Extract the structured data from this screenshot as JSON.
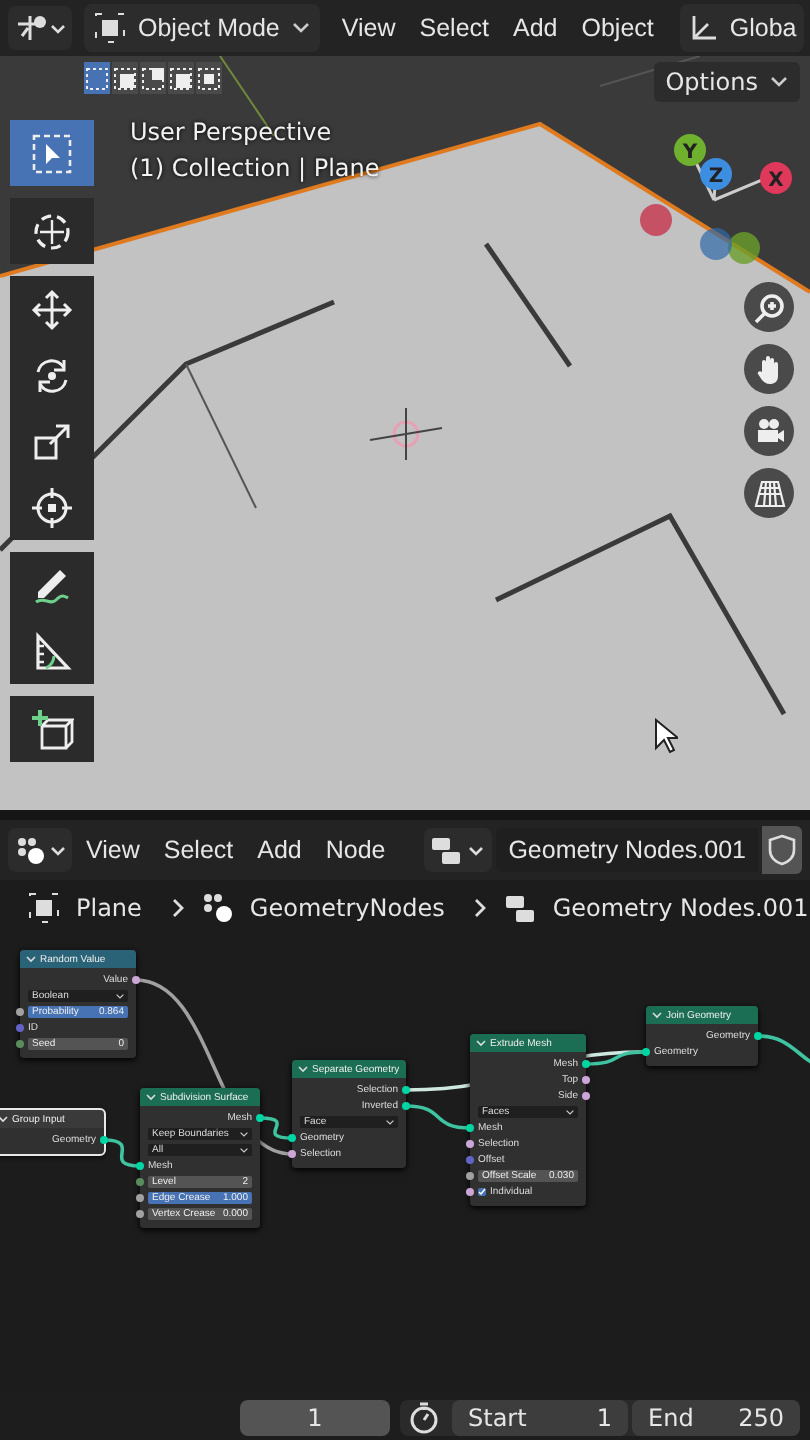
{
  "header": {
    "menus": [
      "View",
      "Select",
      "Add",
      "Object"
    ],
    "mode": "Object Mode",
    "orientation": "Globa"
  },
  "select_modes": [
    {
      "selected": true
    },
    {
      "selected": false
    },
    {
      "selected": false
    },
    {
      "selected": false
    },
    {
      "selected": false
    }
  ],
  "options": "Options",
  "viewport": {
    "view_name": "User Perspective",
    "collection": "(1) Collection | Plane"
  },
  "tools": [
    {
      "kind": "select",
      "selected": true
    },
    {
      "kind": "cursor",
      "selected": false
    },
    {
      "kind": "move",
      "selected": false
    },
    {
      "kind": "rotate",
      "selected": false
    },
    {
      "kind": "scale",
      "selected": false
    },
    {
      "kind": "transform",
      "selected": false
    },
    {
      "kind": "annotate",
      "selected": false
    },
    {
      "kind": "measure",
      "selected": false
    },
    {
      "kind": "add_cube",
      "selected": false
    }
  ],
  "gizmo_axes": [
    "Y",
    "Z",
    "X"
  ],
  "node_editor": {
    "menus": [
      "View",
      "Select",
      "Add",
      "Node"
    ],
    "node_tree": "Geometry Nodes.001",
    "breadcrumbs": [
      "Plane",
      "GeometryNodes",
      "Geometry Nodes.001"
    ],
    "nodes": [
      {
        "title": "Random Value",
        "color": "#2a6378",
        "selected": false,
        "rows": [
          {
            "kind": "output",
            "label": "Value",
            "color": "#cca6d6"
          },
          {
            "kind": "dropdown",
            "label": "Boolean"
          },
          {
            "kind": "field",
            "label": "Probability",
            "value": "0.864",
            "selected": true,
            "color": "#a1a1a1"
          },
          {
            "kind": "input",
            "label": "ID",
            "color": "#6363c7"
          },
          {
            "kind": "field",
            "label": "Seed",
            "value": "0",
            "selected": false,
            "color": "#598c5c"
          }
        ]
      },
      {
        "title": "Group Input",
        "color": "#3a3a3a",
        "selected": true,
        "rows": [
          {
            "kind": "output",
            "label": "Geometry",
            "color": "#00d6a3"
          }
        ]
      },
      {
        "title": "Subdivision Surface",
        "color": "#1b6e53",
        "selected": false,
        "rows": [
          {
            "kind": "output",
            "label": "Mesh",
            "color": "#00d6a3"
          },
          {
            "kind": "dropdown",
            "label": "Keep Boundaries"
          },
          {
            "kind": "dropdown",
            "label": "All"
          },
          {
            "kind": "input",
            "label": "Mesh",
            "color": "#00d6a3"
          },
          {
            "kind": "field",
            "label": "Level",
            "value": "2",
            "selected": false,
            "color": "#598c5c"
          },
          {
            "kind": "field",
            "label": "Edge Crease",
            "value": "1.000",
            "selected": true,
            "color": "#a1a1a1"
          },
          {
            "kind": "field",
            "label": "Vertex Crease",
            "value": "0.000",
            "selected": false,
            "color": "#a1a1a1"
          }
        ]
      },
      {
        "title": "Separate Geometry",
        "color": "#1b6e53",
        "selected": false,
        "rows": [
          {
            "kind": "output",
            "label": "Selection",
            "color": "#00d6a3"
          },
          {
            "kind": "output",
            "label": "Inverted",
            "color": "#00d6a3"
          },
          {
            "kind": "dropdown",
            "label": "Face"
          },
          {
            "kind": "input",
            "label": "Geometry",
            "color": "#00d6a3"
          },
          {
            "kind": "input",
            "label": "Selection",
            "color": "#cca6d6"
          }
        ]
      },
      {
        "title": "Extrude Mesh",
        "color": "#1b6e53",
        "selected": false,
        "rows": [
          {
            "kind": "output",
            "label": "Mesh",
            "color": "#00d6a3"
          },
          {
            "kind": "output",
            "label": "Top",
            "color": "#cca6d6"
          },
          {
            "kind": "output",
            "label": "Side",
            "color": "#cca6d6"
          },
          {
            "kind": "dropdown",
            "label": "Faces"
          },
          {
            "kind": "input",
            "label": "Mesh",
            "color": "#00d6a3"
          },
          {
            "kind": "input",
            "label": "Selection",
            "color": "#cca6d6"
          },
          {
            "kind": "input",
            "label": "Offset",
            "color": "#6363c7"
          },
          {
            "kind": "field",
            "label": "Offset Scale",
            "value": "0.030",
            "selected": false,
            "color": "#a1a1a1"
          },
          {
            "kind": "checkbox",
            "label": "Individual",
            "checked": true,
            "color": "#cca6d6"
          }
        ]
      },
      {
        "title": "Join Geometry",
        "color": "#1b6e53",
        "selected": false,
        "rows": [
          {
            "kind": "output",
            "label": "Geometry",
            "color": "#00d6a3"
          },
          {
            "kind": "input",
            "label": "Geometry",
            "color": "#00d6a3"
          }
        ]
      }
    ]
  },
  "timeline": {
    "current_frame": "1",
    "start_label": "Start",
    "start": "1",
    "end_label": "End",
    "end": "250"
  }
}
